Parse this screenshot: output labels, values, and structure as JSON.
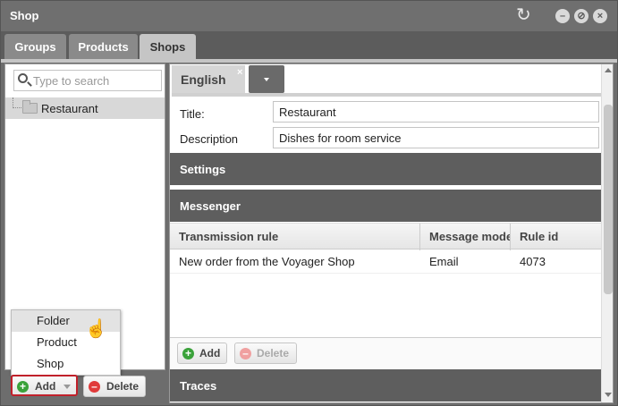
{
  "window": {
    "title": "Shop"
  },
  "tabs": [
    {
      "label": "Groups"
    },
    {
      "label": "Products"
    },
    {
      "label": "Shops"
    }
  ],
  "left": {
    "search_placeholder": "Type to search",
    "tree": [
      {
        "label": "Restaurant"
      }
    ],
    "add_label": "Add",
    "delete_label": "Delete",
    "add_menu": [
      {
        "label": "Folder"
      },
      {
        "label": "Product"
      },
      {
        "label": "Shop"
      }
    ]
  },
  "right": {
    "language_tab": "English",
    "close_glyph": "×",
    "fields": [
      {
        "label": "Title:",
        "value": "Restaurant"
      },
      {
        "label": "Description",
        "value": "Dishes for room service"
      }
    ],
    "settings_header": "Settings",
    "messenger_header": "Messenger",
    "grid": {
      "columns": [
        "Transmission rule",
        "Message mode",
        "Rule id"
      ],
      "rows": [
        [
          "New order from the Voyager Shop",
          "Email",
          "4073"
        ]
      ]
    },
    "grid_add_label": "Add",
    "grid_delete_label": "Delete",
    "traces_header": "Traces"
  },
  "icons": {
    "refresh": "refresh-icon",
    "minimize": "minimize-icon",
    "restore": "restore-icon",
    "close": "close-icon"
  }
}
